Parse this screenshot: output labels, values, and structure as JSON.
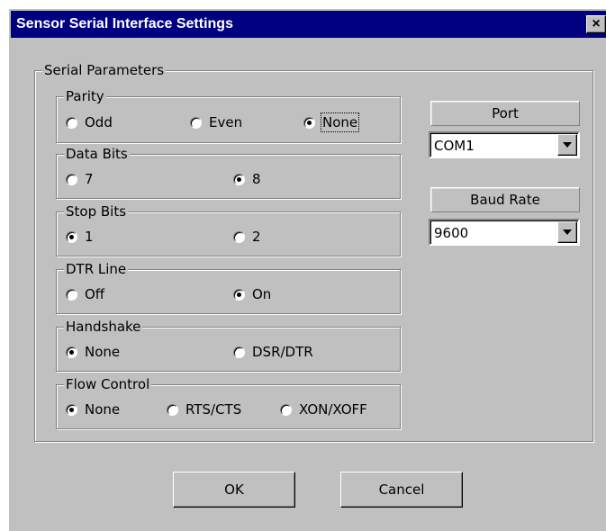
{
  "window": {
    "title": "Sensor Serial Interface Settings",
    "close_glyph": "×"
  },
  "serial_parameters": {
    "legend": "Serial Parameters",
    "parity": {
      "legend": "Parity",
      "options": [
        "Odd",
        "Even",
        "None"
      ],
      "selected": "None"
    },
    "data_bits": {
      "legend": "Data Bits",
      "options": [
        "7",
        "8"
      ],
      "selected": "8"
    },
    "stop_bits": {
      "legend": "Stop Bits",
      "options": [
        "1",
        "2"
      ],
      "selected": "1"
    },
    "dtr_line": {
      "legend": "DTR Line",
      "options": [
        "Off",
        "On"
      ],
      "selected": "On"
    },
    "handshake": {
      "legend": "Handshake",
      "options": [
        "None",
        "DSR/DTR"
      ],
      "selected": "None"
    },
    "flow_control": {
      "legend": "Flow Control",
      "options": [
        "None",
        "RTS/CTS",
        "XON/XOFF"
      ],
      "selected": "None"
    }
  },
  "port": {
    "label": "Port",
    "value": "COM1"
  },
  "baud_rate": {
    "label": "Baud Rate",
    "value": "9600"
  },
  "buttons": {
    "ok": "OK",
    "cancel": "Cancel"
  }
}
